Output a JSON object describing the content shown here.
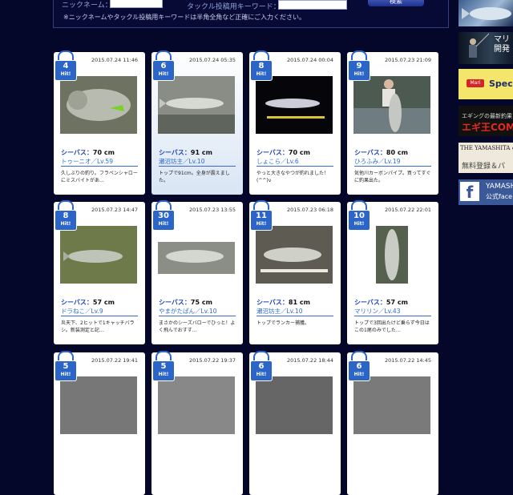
{
  "search": {
    "nickname_label": "ニックネーム：",
    "keyword_label": "タックル投稿用キーワード：",
    "button_label": "検索",
    "note": "※ニックネームやタックル投稿用キーワードは半角全角など正確にご入力ください。",
    "nickname_value": "",
    "keyword_value": ""
  },
  "banners": {
    "b2_text": "マリ\n開発",
    "b3_logo": "Mari",
    "b3_text": "Spec",
    "b4_line1": "エギングの最新釣果マ",
    "b4_line2": "エギ王COM",
    "b5_line1": "THE YAMASHITA &",
    "b5_line2": "無料登録＆パ",
    "b6_line1": "YAMASH",
    "b6_line2": "公式face"
  },
  "hit_label": "Hit!",
  "cards": [
    {
      "hits": "4",
      "date": "2015.07.24 11:46",
      "fish": "シーバス：",
      "size": "70 cm",
      "user": "トゥーニオ／Lv.59",
      "comment": "久しぶりの釣り。フラペンシャローにミスバイトがあ…",
      "highlight": false
    },
    {
      "hits": "6",
      "date": "2015.07.24 05:35",
      "fish": "シーバス：",
      "size": "91 cm",
      "user": "瀬沼坊主／Lv.10",
      "comment": "トップで91cm。全身が震えました。",
      "highlight": true
    },
    {
      "hits": "8",
      "date": "2015.07.24 00:04",
      "fish": "シーバス：",
      "size": "70 cm",
      "user": "しょこら／Lv.6",
      "comment": "やっと大きなやつが釣れました！(^^)v",
      "highlight": false
    },
    {
      "hits": "9",
      "date": "2015.07.23 21:09",
      "fish": "シーバス：",
      "size": "80 cm",
      "user": "ひろふみ／Lv.19",
      "comment": "気他川カーボンパイプ。買ってすぐに釣果出た。",
      "highlight": false
    },
    {
      "hits": "8",
      "date": "2015.07.23 14:47",
      "fish": "シーバス：",
      "size": "57 cm",
      "user": "ドラねこ／Lv.9",
      "comment": "炎天下、2ヒットで1キャッチバラシ。新装測定と記…",
      "highlight": false
    },
    {
      "hits": "30",
      "date": "2015.07.23 13:55",
      "fish": "シーバス：",
      "size": "75 cm",
      "user": "やまがたぱん／Lv.10",
      "comment": "まさかのシーズバローでひっと！よく飛んでおすす…",
      "highlight": false
    },
    {
      "hits": "11",
      "date": "2015.07.23 06:18",
      "fish": "シーバス：",
      "size": "81 cm",
      "user": "瀬沼坊主／Lv.10",
      "comment": "トップでランカー捕獲。",
      "highlight": false
    },
    {
      "hits": "10",
      "date": "2015.07.22 22:01",
      "fish": "シーバス：",
      "size": "57 cm",
      "user": "マリリン／Lv.43",
      "comment": "トップで3回出たけど乗らず今日はこの1尾のみでした…",
      "highlight": false
    },
    {
      "hits": "5",
      "date": "2015.07.22 19:41"
    },
    {
      "hits": "5",
      "date": "2015.07.22 19:37"
    },
    {
      "hits": "6",
      "date": "2015.07.22 18:44"
    },
    {
      "hits": "6",
      "date": "2015.07.22 14:45"
    }
  ]
}
